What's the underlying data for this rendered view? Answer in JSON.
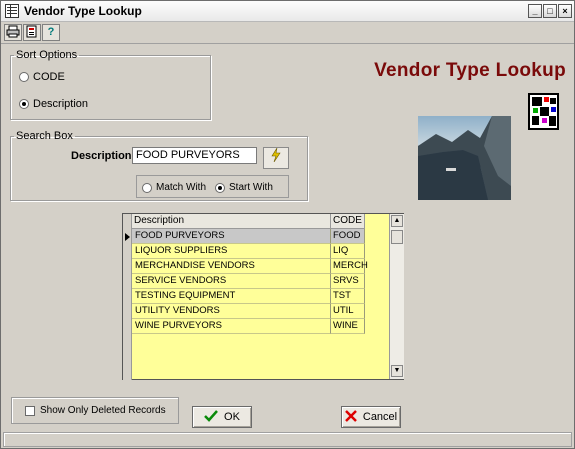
{
  "window": {
    "title": "Vendor Type Lookup"
  },
  "toolbar": {
    "icons": [
      "printer-icon",
      "report-icon",
      "help-icon"
    ],
    "help_label": "?"
  },
  "sort_options": {
    "legend": "Sort Options",
    "options": [
      {
        "label": "CODE",
        "selected": false
      },
      {
        "label": "Description",
        "selected": true
      }
    ]
  },
  "brand": {
    "title": "Vendor Type Lookup",
    "title_color": "#7a0a0a"
  },
  "search_box": {
    "legend": "Search Box",
    "field_label": "Description",
    "field_value": "FOOD PURVEYORS",
    "match_options": [
      {
        "label": "Match With",
        "selected": false
      },
      {
        "label": "Start With",
        "selected": true
      }
    ]
  },
  "grid": {
    "columns": [
      "Description",
      "CODE"
    ],
    "rows": [
      {
        "description": "FOOD PURVEYORS",
        "code": "FOOD",
        "selected": true
      },
      {
        "description": "LIQUOR SUPPLIERS",
        "code": "LIQ",
        "selected": false
      },
      {
        "description": "MERCHANDISE VENDORS",
        "code": "MERCH",
        "selected": false
      },
      {
        "description": "SERVICE VENDORS",
        "code": "SRVS",
        "selected": false
      },
      {
        "description": "TESTING EQUIPMENT",
        "code": "TST",
        "selected": false
      },
      {
        "description": "UTILITY VENDORS",
        "code": "UTIL",
        "selected": false
      },
      {
        "description": "WINE PURVEYORS",
        "code": "WINE",
        "selected": false
      }
    ],
    "background_color": "#ffff99"
  },
  "footer": {
    "show_deleted_label": "Show Only Deleted Records",
    "show_deleted_checked": false,
    "ok_label": "OK",
    "cancel_label": "Cancel"
  }
}
